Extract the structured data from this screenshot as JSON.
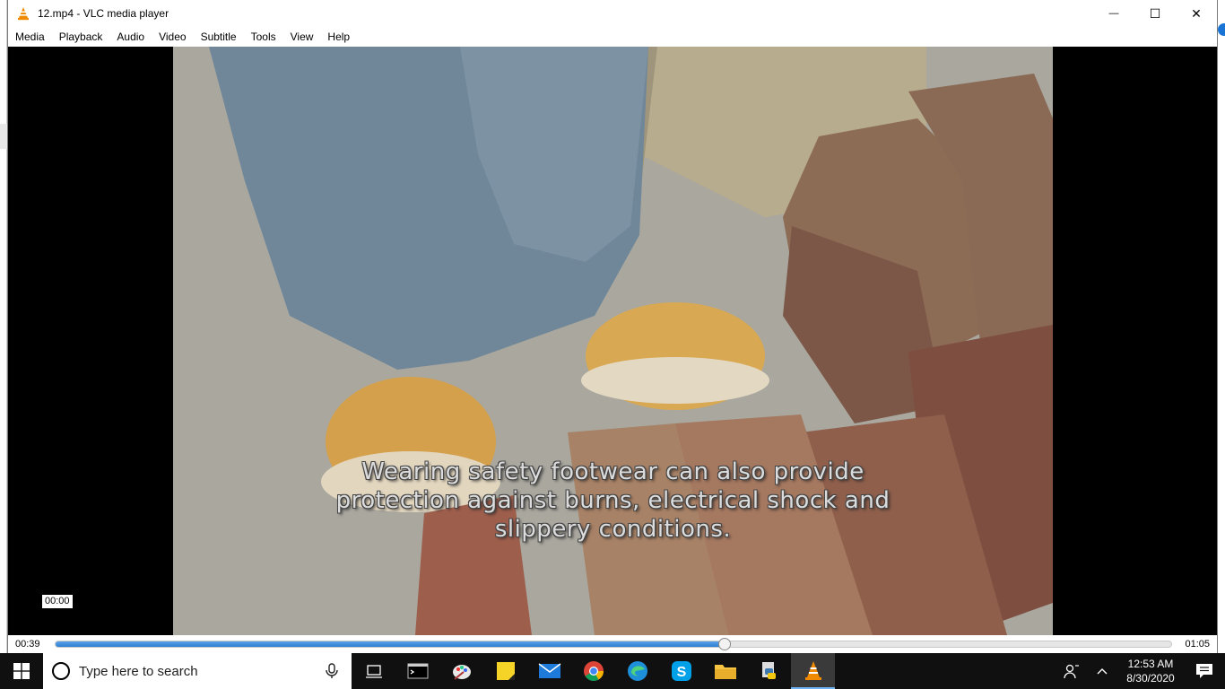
{
  "window": {
    "title": "12.mp4 - VLC media player",
    "minimize_symbol": "—",
    "maximize_symbol": "☐",
    "close_symbol": "✕"
  },
  "menu": {
    "items": [
      "Media",
      "Playback",
      "Audio",
      "Video",
      "Subtitle",
      "Tools",
      "View",
      "Help"
    ]
  },
  "video": {
    "subtitle_lines": [
      "Wearing safety footwear can also provide",
      "protection against burns, electrical shock and",
      "slippery conditions."
    ],
    "hover_tooltip": "00:00"
  },
  "seek": {
    "elapsed": "00:39",
    "total": "01:05",
    "progress": 0.6
  },
  "taskbar": {
    "search_placeholder": "Type here to search",
    "time": "12:53 AM",
    "date": "8/30/2020",
    "icons": [
      "task-view-icon",
      "terminal-icon",
      "paint-icon",
      "sticky-notes-icon",
      "mail-icon",
      "chrome-icon",
      "edge-icon",
      "skype-icon",
      "file-explorer-icon",
      "python-icon",
      "vlc-icon"
    ]
  },
  "colors": {
    "accent": "#2d7fd2",
    "taskbar": "#101010",
    "vlc_orange": "#f08a00"
  }
}
